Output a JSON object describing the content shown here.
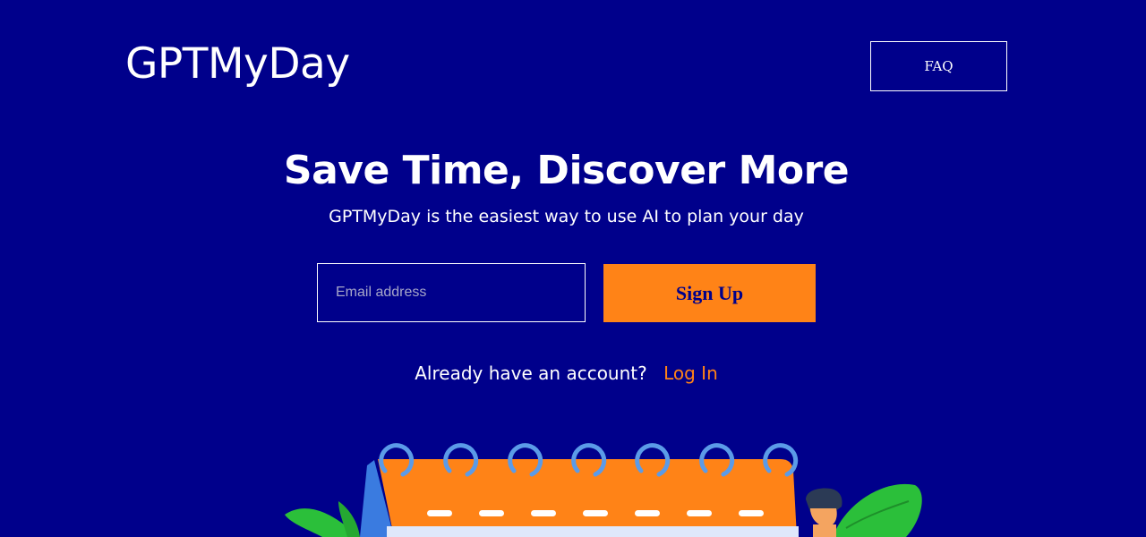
{
  "header": {
    "logo_text": "GPTMyDay",
    "faq_label": "FAQ"
  },
  "hero": {
    "headline": "Save Time, Discover More",
    "subheadline": "GPTMyDay is the easiest way to use AI to plan your day"
  },
  "signup_form": {
    "email_placeholder": "Email address",
    "email_value": "",
    "submit_label": "Sign Up"
  },
  "login": {
    "prompt": "Already have an account?",
    "link_label": "Log In"
  },
  "colors": {
    "background": "#00008b",
    "accent_orange": "#ff8317",
    "text_white": "#ffffff",
    "calendar_ring": "#4a90e2",
    "leaf_green": "#2bbf3a"
  },
  "illustration": {
    "icons": [
      "calendar-illustration",
      "person-illustration",
      "leaf-left-illustration",
      "leaf-right-illustration"
    ]
  }
}
